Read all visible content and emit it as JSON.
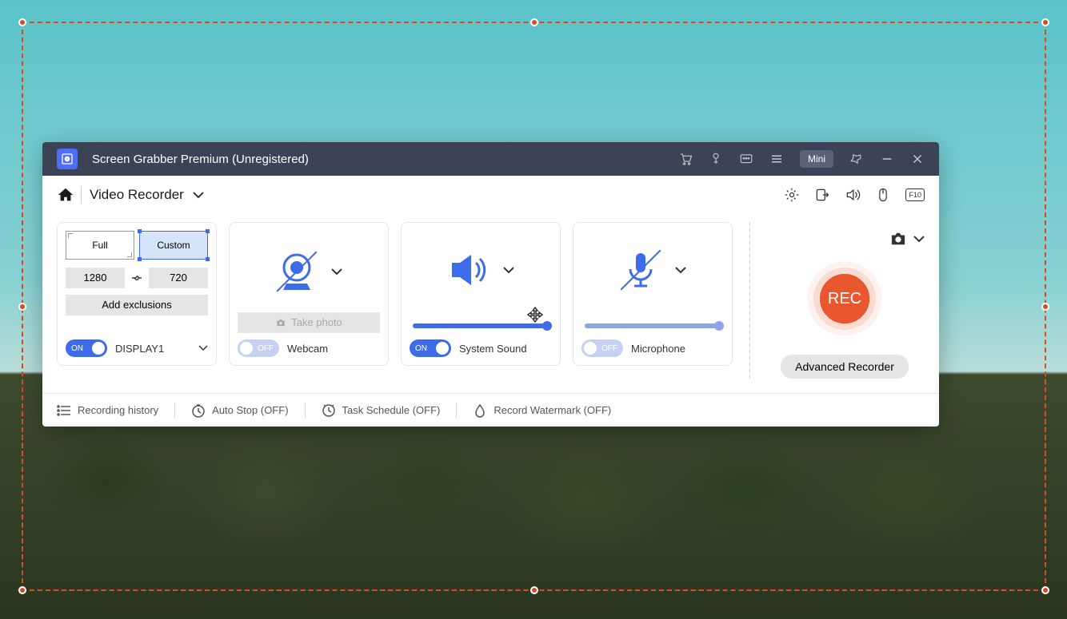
{
  "titlebar": {
    "title": "Screen Grabber Premium (Unregistered)",
    "mini": "Mini"
  },
  "toolbar": {
    "mode": "Video Recorder",
    "f10": "F10"
  },
  "display_card": {
    "full": "Full",
    "custom": "Custom",
    "width": "1280",
    "height": "720",
    "exclusions": "Add exclusions",
    "toggle": "ON",
    "label": "DISPLAY1"
  },
  "webcam_card": {
    "take_photo": "Take photo",
    "toggle": "OFF",
    "label": "Webcam"
  },
  "sound_card": {
    "toggle": "ON",
    "label": "System Sound"
  },
  "mic_card": {
    "toggle": "OFF",
    "label": "Microphone"
  },
  "rec": {
    "button": "REC",
    "advanced": "Advanced Recorder"
  },
  "footer": {
    "history": "Recording history",
    "autostop": "Auto Stop (OFF)",
    "schedule": "Task Schedule (OFF)",
    "watermark": "Record Watermark (OFF)"
  }
}
